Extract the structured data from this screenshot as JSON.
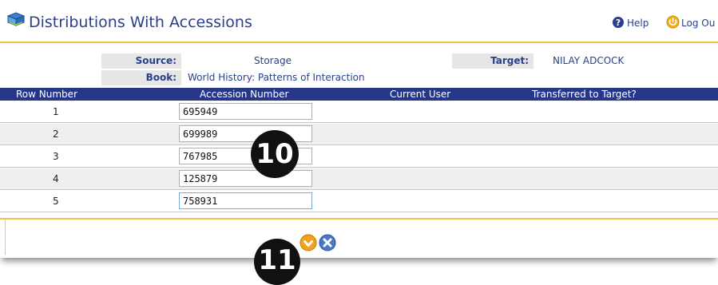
{
  "header": {
    "title": "Distributions With Accessions",
    "help_label": "Help",
    "logout_label": "Log Ou"
  },
  "info": {
    "source_label": "Source:",
    "source_value": "Storage",
    "book_label": "Book:",
    "book_value": "World History: Patterns of Interaction",
    "target_label": "Target:",
    "target_value": "NILAY ADCOCK"
  },
  "table": {
    "columns": [
      "Row Number",
      "Accession Number",
      "Current User",
      "Transferred to Target?"
    ],
    "rows": [
      {
        "number": "1",
        "accession": "695949"
      },
      {
        "number": "2",
        "accession": "699989"
      },
      {
        "number": "3",
        "accession": "767985"
      },
      {
        "number": "4",
        "accession": "125879"
      },
      {
        "number": "5",
        "accession": "758931"
      }
    ]
  },
  "callouts": {
    "step10": "10",
    "step11": "11"
  },
  "icons": {
    "book": "book-icon",
    "help": "help-icon",
    "logout": "logout-icon",
    "submit": "down-arrow-icon",
    "cancel": "close-icon"
  },
  "colors": {
    "header_text": "#2a3f8c",
    "table_header_bg": "#26378a",
    "accent_line": "#f0c24a",
    "label_bg": "#e6e6e6"
  }
}
